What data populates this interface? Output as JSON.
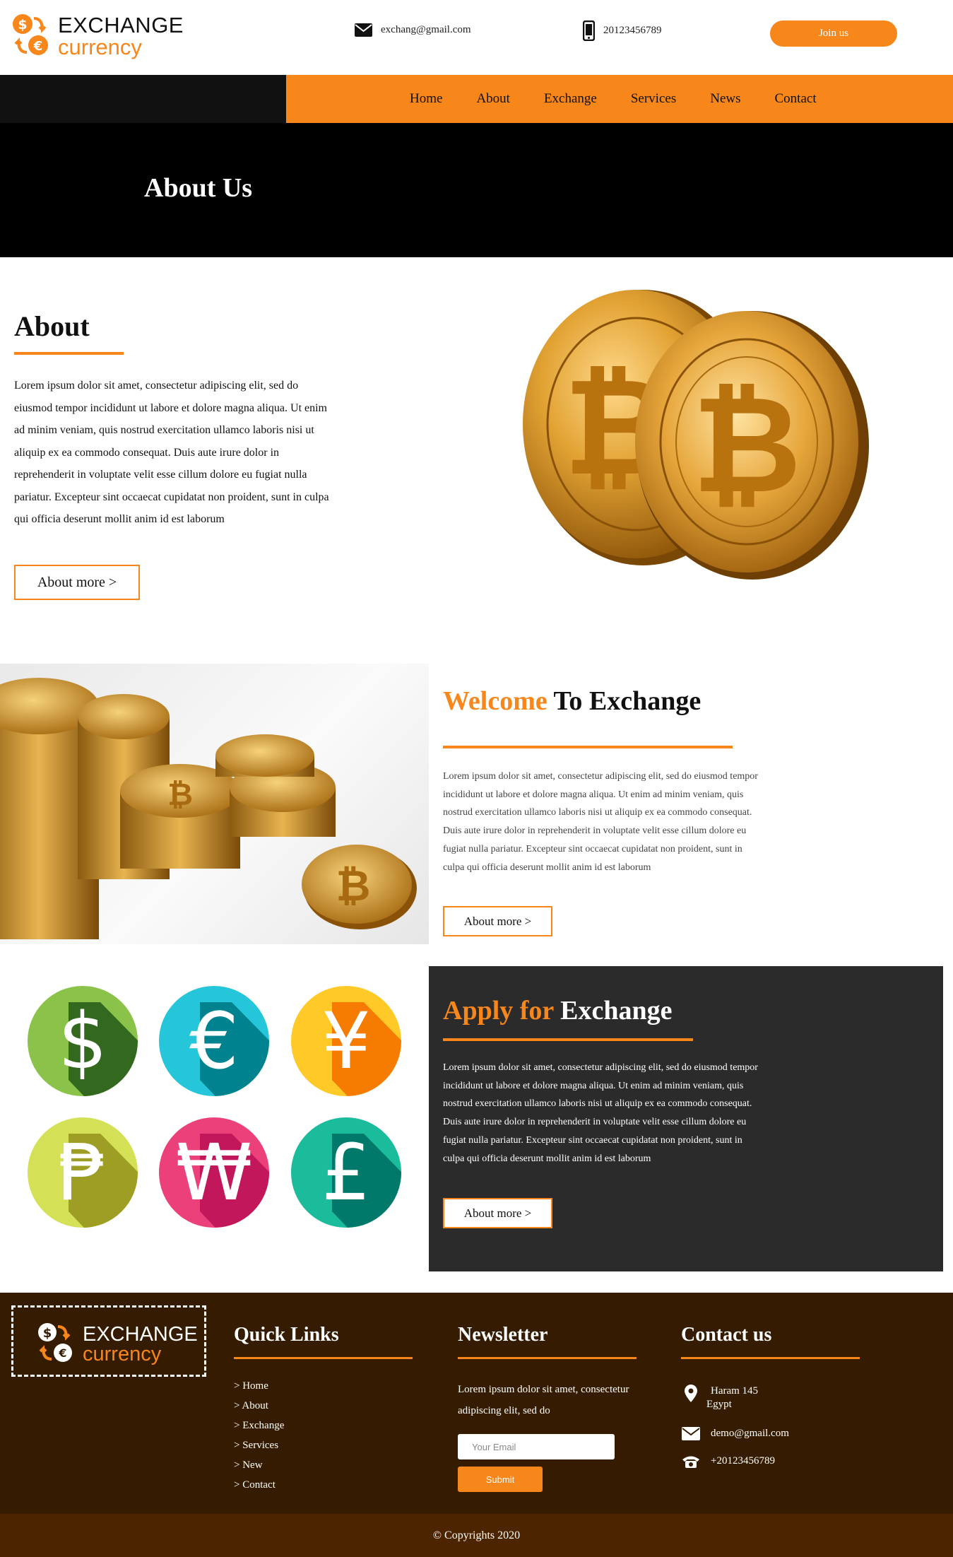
{
  "header": {
    "logo_line1": "EXCHANGE",
    "logo_line2": "currency",
    "email": "exchang@gmail.com",
    "phone": "20123456789",
    "join_label": "Join us"
  },
  "nav": {
    "items": [
      "Home",
      "About",
      "Exchange",
      "Services",
      "News",
      "Contact"
    ]
  },
  "banner": {
    "title": "About Us"
  },
  "about": {
    "title": "About",
    "text": "Lorem ipsum dolor sit amet, consectetur adipiscing elit, sed do eiusmod tempor incididunt ut labore et dolore magna aliqua. Ut enim ad minim veniam, quis nostrud exercitation ullamco laboris nisi ut aliquip ex ea commodo consequat. Duis aute irure dolor in reprehenderit in voluptate velit esse cillum dolore eu fugiat nulla pariatur. Excepteur sint occaecat cupidatat non proident, sunt in culpa qui officia deserunt mollit anim id est laborum",
    "button": "About more >"
  },
  "welcome": {
    "title_accent": "Welcome",
    "title_rest": " To Exchange",
    "text": "Lorem ipsum dolor sit amet, consectetur adipiscing elit, sed do eiusmod tempor incididunt ut labore et dolore magna aliqua. Ut enim ad minim veniam, quis nostrud exercitation ullamco laboris nisi ut aliquip ex ea commodo consequat. Duis aute irure dolor in reprehenderit in voluptate velit esse cillum dolore eu fugiat nulla pariatur. Excepteur sint occaecat cupidatat non proident, sunt in culpa qui officia deserunt mollit anim id est laborum",
    "button": "About more >"
  },
  "apply": {
    "title_accent": "Apply for",
    "title_rest": " Exchange",
    "text": "Lorem ipsum dolor sit amet, consectetur adipiscing elit, sed do eiusmod tempor incididunt ut labore et dolore magna aliqua. Ut enim ad minim veniam, quis nostrud exercitation ullamco laboris nisi ut aliquip ex ea commodo consequat. Duis aute irure dolor in reprehenderit in voluptate velit esse cillum dolore eu fugiat nulla pariatur. Excepteur sint occaecat cupidatat non proident, sunt in culpa qui officia deserunt mollit anim id est laborum",
    "button": "About more >"
  },
  "currencies": [
    {
      "symbol": "$",
      "color": "#8bc34a",
      "shade": "#33691e",
      "icon": "dollar-icon"
    },
    {
      "symbol": "€",
      "color": "#26c6da",
      "shade": "#00838f",
      "icon": "euro-icon"
    },
    {
      "symbol": "¥",
      "color": "#ffca28",
      "shade": "#f57c00",
      "icon": "yen-icon"
    },
    {
      "symbol": "₱",
      "color": "#d4e157",
      "shade": "#9e9d24",
      "icon": "peso-icon"
    },
    {
      "symbol": "₩",
      "color": "#ec407a",
      "shade": "#c2185b",
      "icon": "won-icon"
    },
    {
      "symbol": "£",
      "color": "#1abc9c",
      "shade": "#00796b",
      "icon": "pound-icon"
    }
  ],
  "footer": {
    "logo_line1": "EXCHANGE",
    "logo_line2": "currency",
    "quick_links_title": "Quick Links",
    "quick_links": [
      "> Home",
      "> About",
      "> Exchange",
      "> Services",
      "> New",
      "> Contact"
    ],
    "newsletter_title": "Newsletter",
    "newsletter_text": "Lorem ipsum dolor sit amet, consectetur adipiscing elit, sed do",
    "email_placeholder": "Your Email",
    "submit_label": "Submit",
    "contact_title": "Contact us",
    "address_line1": "Haram 145",
    "address_line2": "Egypt",
    "contact_email": "demo@gmail.com",
    "contact_phone": "+20123456789"
  },
  "copyright": "© Copyrights 2020",
  "colors": {
    "accent": "#f7861b",
    "footer_bg": "#351c00",
    "dark_box": "#2b2b2b"
  }
}
